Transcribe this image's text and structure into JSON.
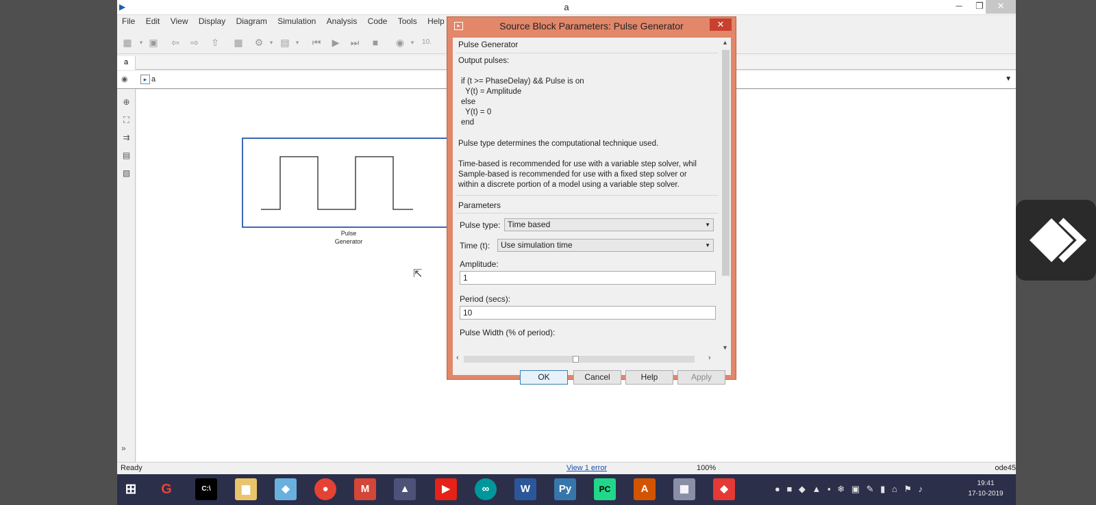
{
  "window": {
    "title": "a",
    "min": "─",
    "restore": "❐",
    "close": "✕"
  },
  "menu": [
    "File",
    "Edit",
    "View",
    "Display",
    "Diagram",
    "Simulation",
    "Analysis",
    "Code",
    "Tools",
    "Help"
  ],
  "toolbar": {
    "time_field": "10."
  },
  "tab": {
    "label": "a"
  },
  "address": {
    "path": "a"
  },
  "block": {
    "label_line1": "Pulse",
    "label_line2": "Generator"
  },
  "status": {
    "ready": "Ready",
    "error_link": "View 1 error",
    "zoom": "100%",
    "solver": "ode45"
  },
  "dialog": {
    "title": "Source Block Parameters: Pulse Generator",
    "close": "✕",
    "section_title": "Pulse Generator",
    "output_heading": "Output pulses:",
    "code_lines": [
      "if (t >= PhaseDelay) && Pulse is on",
      "  Y(t) = Amplitude",
      "else",
      "  Y(t) = 0",
      "end"
    ],
    "desc1": "Pulse type determines the computational technique used.",
    "desc2_line1": "Time-based is recommended for use with a variable step solver, whil",
    "desc2_line2": "Sample-based is recommended for use with a fixed step solver or",
    "desc2_line3": "within a discrete portion of a model using a variable step solver.",
    "params_title": "Parameters",
    "pulse_type_label": "Pulse type:",
    "pulse_type_value": "Time based",
    "time_label": "Time (t):",
    "time_value": "Use simulation time",
    "amplitude_label": "Amplitude:",
    "amplitude_value": "1",
    "period_label": "Period (secs):",
    "period_value": "10",
    "width_label": "Pulse Width (% of period):",
    "buttons": {
      "ok": "OK",
      "cancel": "Cancel",
      "help": "Help",
      "apply": "Apply"
    }
  },
  "taskbar": {
    "clock_time": "19:41",
    "clock_date": "17-10-2019"
  },
  "colors": {
    "dialog_frame": "#e2876a",
    "block_border": "#3b67b4",
    "taskbar": "#2b2f4a",
    "link": "#1a4fb0"
  }
}
